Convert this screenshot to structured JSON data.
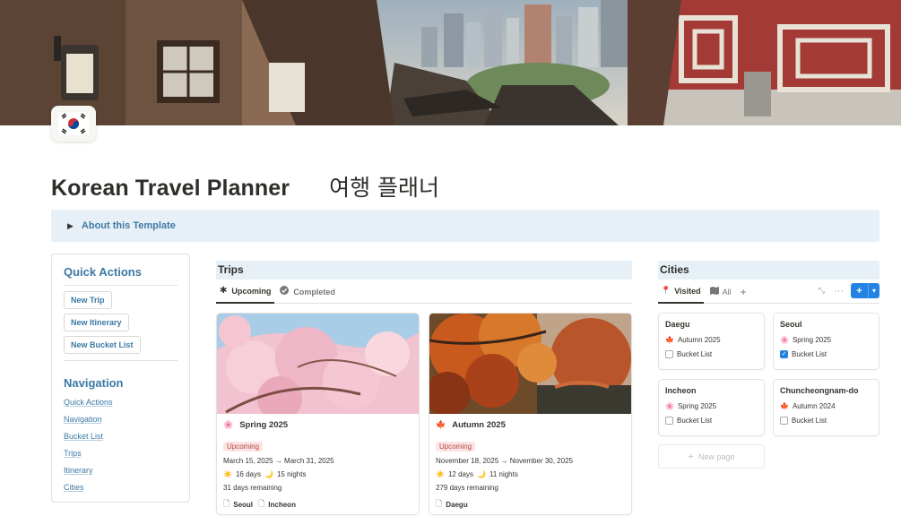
{
  "page": {
    "title": "Korean Travel Planner",
    "title_korean": "여행 플래너",
    "about_toggle": "About this Template"
  },
  "quick_actions": {
    "title": "Quick Actions",
    "buttons": [
      "New Trip",
      "New Itinerary",
      "New Bucket List"
    ]
  },
  "navigation": {
    "title": "Navigation",
    "links": [
      "Quick Actions",
      "Navigation",
      "Bucket List",
      "Trips",
      "Itinerary",
      "Cities"
    ]
  },
  "trips": {
    "title": "Trips",
    "tabs": [
      {
        "label": "Upcoming",
        "icon": "asterisk-icon",
        "active": true
      },
      {
        "label": "Completed",
        "icon": "check-circle-icon",
        "active": false
      }
    ],
    "cards": [
      {
        "image": "cherry-blossom-photo",
        "season": "Spring 2025",
        "season_icon": "cherry-blossom-icon",
        "status": "Upcoming",
        "dates": "March 15, 2025 → March 31, 2025",
        "days": "16 days",
        "nights": "15 nights",
        "remaining": "31 days remaining",
        "cities": [
          "Seoul",
          "Incheon"
        ]
      },
      {
        "image": "autumn-maple-photo",
        "season": "Autumn 2025",
        "season_icon": "maple-leaf-icon",
        "status": "Upcoming",
        "dates": "November 18, 2025 → November 30, 2025",
        "days": "12 days",
        "nights": "11 nights",
        "remaining": "279 days remaining",
        "cities": [
          "Daegu"
        ]
      }
    ]
  },
  "cities": {
    "title": "Cities",
    "tabs": [
      {
        "label": "Visited",
        "icon": "pin-icon",
        "active": true
      },
      {
        "label": "All",
        "icon": "map-icon",
        "active": false
      }
    ],
    "add_view": "+",
    "new_button": "+",
    "new_page": "New page",
    "cards": [
      {
        "name": "Daegu",
        "season": "Autumn 2025",
        "season_icon": "maple-leaf-icon",
        "bucket_list_label": "Bucket List",
        "bucket_list": false
      },
      {
        "name": "Seoul",
        "season": "Spring 2025",
        "season_icon": "cherry-blossom-icon",
        "bucket_list_label": "Bucket List",
        "bucket_list": true
      },
      {
        "name": "Incheon",
        "season": "Spring 2025",
        "season_icon": "cherry-blossom-icon",
        "bucket_list_label": "Bucket List",
        "bucket_list": false
      },
      {
        "name": "Chuncheongnam-do",
        "season": "Autumn 2024",
        "season_icon": "maple-leaf-icon",
        "bucket_list_label": "Bucket List",
        "bucket_list": false
      }
    ]
  },
  "colors": {
    "accent_blue": "#3b79a4",
    "callout_bg": "#e7f0f7",
    "badge_bg": "#fbe4e4",
    "badge_text": "#b4473f",
    "button_blue": "#2383e2"
  }
}
